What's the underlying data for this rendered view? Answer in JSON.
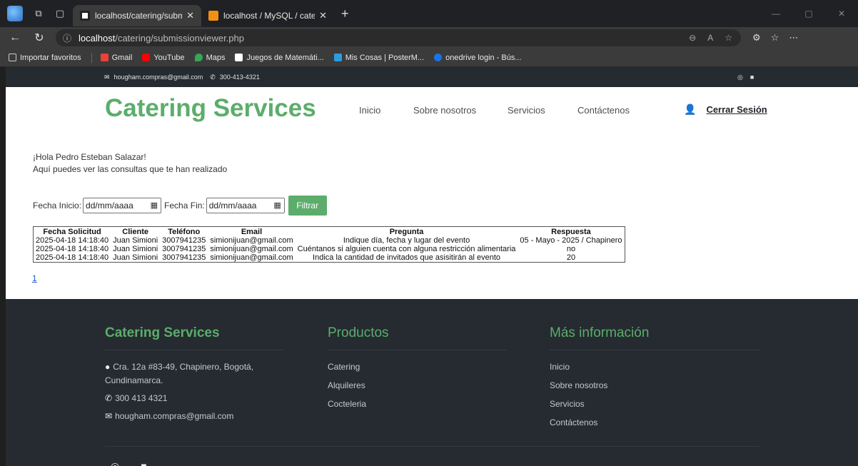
{
  "browser": {
    "tabs": [
      {
        "title": "localhost/catering/submissionvie",
        "active": true
      },
      {
        "title": "localhost / MySQL / cateringdb / ",
        "active": false
      }
    ],
    "new_tab": "+",
    "url_host": "localhost",
    "url_path": "/catering/submissionviewer.php",
    "bookmarks": [
      {
        "label": "Importar favoritos",
        "icon": "import-icon",
        "color": "#cccccc"
      },
      {
        "label": "Gmail",
        "icon": "gmail-icon",
        "color": "#ea4335"
      },
      {
        "label": "YouTube",
        "icon": "youtube-icon",
        "color": "#ff0000"
      },
      {
        "label": "Maps",
        "icon": "maps-icon",
        "color": "#34a853"
      },
      {
        "label": "Juegos de Matemáti...",
        "icon": "cmath-icon",
        "color": "#ffffff"
      },
      {
        "label": "Mis Cosas | PosterM...",
        "icon": "posterm-icon",
        "color": "#2f9be0"
      },
      {
        "label": "onedrive login - Bús...",
        "icon": "bing-icon",
        "color": "#1a73e8"
      }
    ]
  },
  "topbar": {
    "email": "hougham.compras@gmail.com",
    "phone": "300-413-4321"
  },
  "header": {
    "brand": "Catering Services",
    "nav": [
      "Inicio",
      "Sobre nosotros",
      "Servicios",
      "Contáctenos"
    ],
    "logout": "Cerrar Sesión"
  },
  "main": {
    "greeting": "¡Hola Pedro Esteban Salazar!",
    "subtitle": "Aquí puedes ver las consultas que te han realizado",
    "filter": {
      "start_label": "Fecha Inicio:",
      "start_value": "dd/mm/aaaa",
      "end_label": "Fecha Fin:",
      "end_value": "dd/mm/aaaa",
      "button": "Filtrar"
    },
    "table": {
      "headers": [
        "Fecha Solicitud",
        "Cliente",
        "Teléfono",
        "Email",
        "Pregunta",
        "Respuesta"
      ],
      "rows": [
        [
          "2025-04-18 14:18:40",
          "Juan Simioni",
          "3007941235",
          "simionijuan@gmail.com",
          "Indique día, fecha y lugar del evento",
          "05 - Mayo - 2025 / Chapinero"
        ],
        [
          "2025-04-18 14:18:40",
          "Juan Simioni",
          "3007941235",
          "simionijuan@gmail.com",
          "Cuéntanos si alguien cuenta con alguna restricción alimentaria",
          "no"
        ],
        [
          "2025-04-18 14:18:40",
          "Juan Simioni",
          "3007941235",
          "simionijuan@gmail.com",
          "Indica la cantidad de invitados que asisitirán al evento",
          "20"
        ]
      ]
    },
    "page": "1"
  },
  "footer": {
    "brand": "Catering Services",
    "address_line1": "Cra. 12a #83-49, Chapinero, Bogotá,",
    "address_line2": "Cundinamarca.",
    "phone": "300 413 4321",
    "email": "hougham.compras@gmail.com",
    "products_title": "Productos",
    "products": [
      "Catering",
      "Alquileres",
      "Cocteleria"
    ],
    "info_title": "Más información",
    "info_links": [
      "Inicio",
      "Sobre nosotros",
      "Servicios",
      "Contáctenos"
    ]
  },
  "colors": {
    "brand_green": "#5cad6b",
    "dark_bg": "#252b31"
  }
}
